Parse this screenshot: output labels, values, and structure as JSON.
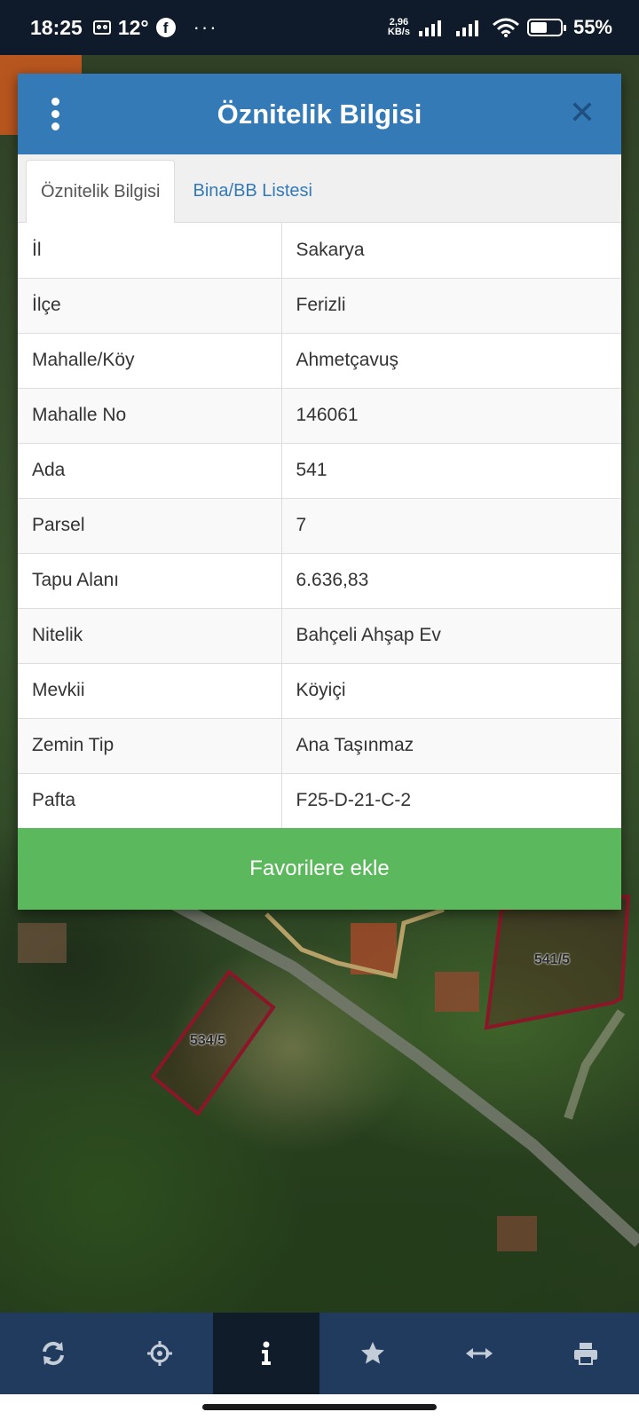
{
  "status_bar": {
    "time": "18:25",
    "temperature": "12°",
    "speed_value": "2,96",
    "speed_unit": "KB/s",
    "battery_percent": "55%",
    "battery_level": 0.55
  },
  "map": {
    "parcel_labels": [
      "534/5",
      "541/5"
    ]
  },
  "modal": {
    "title": "Öznitelik Bilgisi",
    "tabs": [
      {
        "label": "Öznitelik Bilgisi",
        "active": true
      },
      {
        "label": "Bina/BB Listesi",
        "active": false
      }
    ],
    "rows": [
      {
        "key": "İl",
        "value": "Sakarya"
      },
      {
        "key": "İlçe",
        "value": "Ferizli"
      },
      {
        "key": "Mahalle/Köy",
        "value": "Ahmetçavuş"
      },
      {
        "key": "Mahalle No",
        "value": "146061"
      },
      {
        "key": "Ada",
        "value": "541"
      },
      {
        "key": "Parsel",
        "value": "7"
      },
      {
        "key": "Tapu Alanı",
        "value": "6.636,83"
      },
      {
        "key": "Nitelik",
        "value": "Bahçeli Ahşap Ev"
      },
      {
        "key": "Mevkii",
        "value": "Köyiçi"
      },
      {
        "key": "Zemin Tip",
        "value": "Ana Taşınmaz"
      },
      {
        "key": "Pafta",
        "value": "F25-D-21-C-2"
      }
    ],
    "favorite_button": "Favorilere ekle"
  },
  "toolbar": {
    "items": [
      {
        "icon": "refresh-icon",
        "active": false
      },
      {
        "icon": "locate-icon",
        "active": false
      },
      {
        "icon": "info-icon",
        "active": true
      },
      {
        "icon": "star-icon",
        "active": false
      },
      {
        "icon": "measure-icon",
        "active": false
      },
      {
        "icon": "print-icon",
        "active": false
      }
    ]
  },
  "colors": {
    "header": "#337ab7",
    "favorite_button": "#5cb85c",
    "toolbar": "#213b5f",
    "toolbar_active": "#101c2a"
  }
}
